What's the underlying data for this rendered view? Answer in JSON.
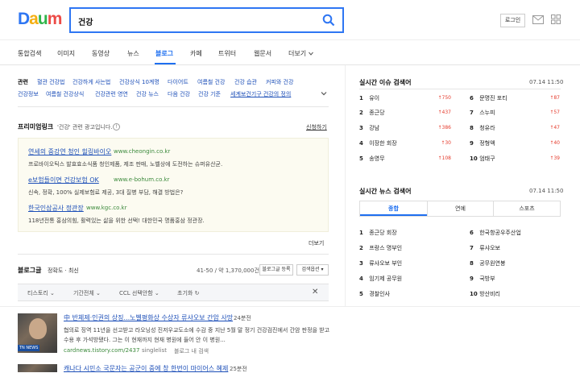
{
  "header": {
    "logo": [
      "D",
      "a",
      "u",
      "m"
    ],
    "query": "건강",
    "login": "로그인"
  },
  "nav": [
    "통합검색",
    "이미지",
    "동영상",
    "뉴스",
    "블로그",
    "카페",
    "트위터",
    "웹문서",
    "더보기"
  ],
  "related": {
    "title": "관련",
    "row1": [
      "혈관 건강법",
      "건강하게 사는법",
      "건강상식 10계명",
      "다이어트",
      "여름철 건강",
      "건강 습관",
      "커피와 건강"
    ],
    "row2": [
      "건강정보",
      "여름철 건강상식",
      "건강관련 영연",
      "건강 뉴스",
      "다음 건강",
      "건강 기준",
      "세계보건기구 건강의 정의"
    ]
  },
  "premium": {
    "title": "프리미엄링크",
    "sub": "'건강' 관련 광고입니다.",
    "apply": "신청하기",
    "more": "더보기",
    "ads": [
      {
        "title": "연세의 중강연 청인 힐링바이오",
        "url": "www.cheongin.co.kr",
        "desc": "프로바이오틱스 발효효소식품 청인제품, 제조 판매, 노벨상에 도전하는 슈퍼유산균."
      },
      {
        "title": "e보험들이면 건강보험 OK",
        "url": "www.e-bohum.co.kr",
        "desc": "신속, 정확, 100% 실제보험료 제공, 3대 질병 부담, 해결 방법은?"
      },
      {
        "title": "한국인삼공사 정관장",
        "url": "www.kgc.co.kr",
        "desc": "118년전통 홍삼의힘, 활력있는 삶을 위한 선택! 대한민국 명품홍삼 정관장."
      }
    ]
  },
  "blog": {
    "title": "블로그글",
    "sort": "정확도 · 최신",
    "count": "41-50 / 약 1,370,000건",
    "register": "블로그글 등록",
    "options": "검색옵션",
    "filters": [
      "티스토리",
      "기간전체",
      "CCL 선택안함",
      "초기화"
    ],
    "results": [
      {
        "title": "中 반체제·인권의 상징...노벨평화상 수상자 류샤오보 간암 사망",
        "time": "24분전",
        "desc1": "협의로 징역 11년을 선고받고 라오닝성 진저우교도소에 수감 중 지난 5월 말 정기 건강검진에서 간암 판정을 받고",
        "desc2": "수용 후 가석방됐다. 그는 이 현재까지 현재 병원에 들어 안 이 병원...",
        "url": "cardnews.tistory.com/2437",
        "blog": "singlelist",
        "kw": "블로그 내 검색",
        "thumbtag": "TN NEWS"
      },
      {
        "title": "캐나다 시민소 국문자는 공군이 중에 창 한번이 마이어스 혜제",
        "time": "25분전"
      }
    ]
  },
  "issues": {
    "title": "실시간 이슈 검색어",
    "date": "07.14  11:50",
    "left": [
      {
        "n": "1",
        "t": "유이",
        "v": "750"
      },
      {
        "n": "2",
        "t": "종근당",
        "v": "437"
      },
      {
        "n": "3",
        "t": "강남",
        "v": "386"
      },
      {
        "n": "4",
        "t": "이장한 회장",
        "v": "30"
      },
      {
        "n": "5",
        "t": "송영무",
        "v": "108"
      }
    ],
    "right": [
      {
        "n": "6",
        "t": "문명진 포티",
        "v": "87"
      },
      {
        "n": "7",
        "t": "스누피",
        "v": "57"
      },
      {
        "n": "8",
        "t": "청유라",
        "v": "47"
      },
      {
        "n": "9",
        "t": "정형액",
        "v": "40"
      },
      {
        "n": "10",
        "t": "엄태구",
        "v": "39"
      }
    ]
  },
  "news": {
    "title": "실시간 뉴스 검색어",
    "date": "07.14  11:50",
    "tabs": [
      "종합",
      "연예",
      "스포츠"
    ],
    "left": [
      {
        "n": "1",
        "t": "종근당 회장"
      },
      {
        "n": "2",
        "t": "프랑스 명부인"
      },
      {
        "n": "3",
        "t": "류샤오보 부인"
      },
      {
        "n": "4",
        "t": "임기제 공무원"
      },
      {
        "n": "5",
        "t": "경찰인사"
      }
    ],
    "right": [
      {
        "n": "6",
        "t": "한국항공우주산업"
      },
      {
        "n": "7",
        "t": "류샤오보"
      },
      {
        "n": "8",
        "t": "공무원연봉"
      },
      {
        "n": "9",
        "t": "국방부"
      },
      {
        "n": "10",
        "t": "방산비리"
      }
    ]
  },
  "colors": {
    "accent": "#1e6ff0",
    "link": "#1d4fb8",
    "up": "#e53b2c"
  }
}
